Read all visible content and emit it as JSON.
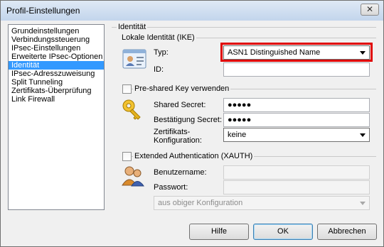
{
  "window": {
    "title": "Profil-Einstellungen",
    "close_glyph": "✕"
  },
  "nav": {
    "items": [
      {
        "label": "Grundeinstellungen",
        "selected": false
      },
      {
        "label": "Verbindungssteuerung",
        "selected": false
      },
      {
        "label": "IPsec-Einstellungen",
        "selected": false
      },
      {
        "label": "Erweiterte IPsec-Optionen",
        "selected": false
      },
      {
        "label": "Identität",
        "selected": true
      },
      {
        "label": "IPsec-Adresszuweisung",
        "selected": false
      },
      {
        "label": "Split Tunneling",
        "selected": false
      },
      {
        "label": "Zertifikats-Überprüfung",
        "selected": false
      },
      {
        "label": "Link Firewall",
        "selected": false
      }
    ]
  },
  "identity": {
    "group_title": "Identität",
    "ike_section": "Lokale Identität (IKE)",
    "typ_label": "Typ:",
    "typ_value": "ASN1 Distinguished Name",
    "id_label": "ID:",
    "id_value": "",
    "psk_label": "Pre-shared Key verwenden",
    "psk_checked": false,
    "shared_secret_label": "Shared Secret:",
    "shared_secret_value": "●●●●●",
    "confirm_secret_label": "Bestätigung Secret:",
    "confirm_secret_value": "●●●●●",
    "cert_config_label_1": "Zertifikats-",
    "cert_config_label_2": "Konfiguration:",
    "cert_config_value": "keine",
    "xauth_label": "Extended Authentication (XAUTH)",
    "xauth_checked": false,
    "username_label": "Benutzername:",
    "username_value": "",
    "password_label": "Passwort:",
    "password_value": "",
    "source_value": "aus obiger Konfiguration"
  },
  "buttons": {
    "help": "Hilfe",
    "ok": "OK",
    "cancel": "Abbrechen"
  },
  "colors": {
    "highlight": "#e00000",
    "selection": "#3399ff"
  },
  "icons": [
    "id-card-icon",
    "key-icon",
    "users-icon"
  ]
}
